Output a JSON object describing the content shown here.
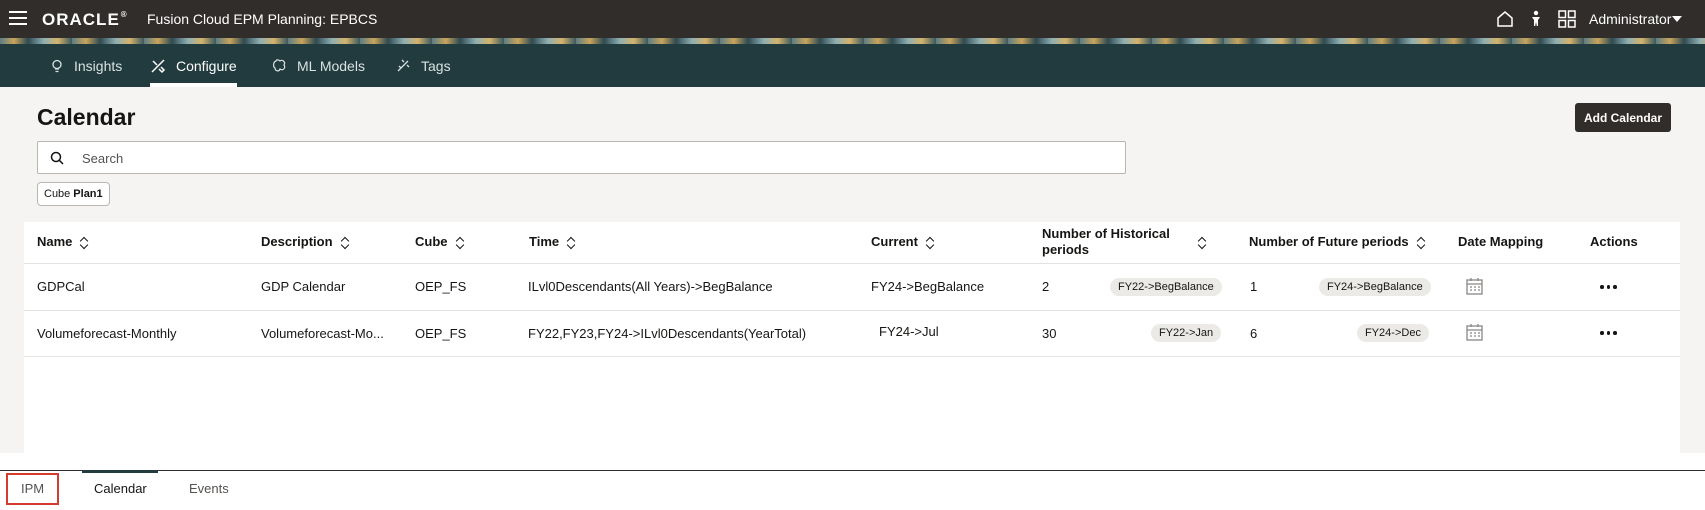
{
  "header": {
    "brand": "ORACLE",
    "app_title": "Fusion Cloud EPM Planning:  EPBCS",
    "user": "Administrator"
  },
  "nav": {
    "tabs": [
      {
        "label": "Insights",
        "icon": "lightbulb-icon"
      },
      {
        "label": "Configure",
        "icon": "tools-icon",
        "active": true
      },
      {
        "label": "ML Models",
        "icon": "brain-icon"
      },
      {
        "label": "Tags",
        "icon": "tag-icon"
      }
    ]
  },
  "page": {
    "title": "Calendar",
    "add_button": "Add Calendar",
    "search_placeholder": "Search",
    "filter_chip": {
      "label": "Cube",
      "value": "Plan1"
    }
  },
  "table": {
    "columns": [
      "Name",
      "Description",
      "Cube",
      "Time",
      "Current",
      "Number of Historical periods",
      "Number of Future periods",
      "Date Mapping",
      "Actions"
    ],
    "rows": [
      {
        "name": "GDPCal",
        "description": "GDP Calendar",
        "cube": "OEP_FS",
        "time": "ILvl0Descendants(All Years)->BegBalance",
        "current": "FY24->BegBalance",
        "historical_count": "2",
        "historical_start": "FY22->BegBalance",
        "future_count": "1",
        "future_end": "FY24->BegBalance"
      },
      {
        "name": "Volumeforecast-Monthly",
        "description": "Volumeforecast-Mo...",
        "cube": "OEP_FS",
        "time": "FY22,FY23,FY24->ILvl0Descendants(YearTotal)",
        "current": "FY24->Jul",
        "historical_count": "30",
        "historical_start": "FY22->Jan",
        "future_count": "6",
        "future_end": "FY24->Dec"
      }
    ]
  },
  "bottom_tabs": [
    {
      "label": "IPM"
    },
    {
      "label": "Calendar",
      "active": true
    },
    {
      "label": "Events"
    }
  ],
  "colors": {
    "header_bg": "#312d2a",
    "nav_bg": "#223b3e",
    "highlight_box": "#d63b30"
  }
}
